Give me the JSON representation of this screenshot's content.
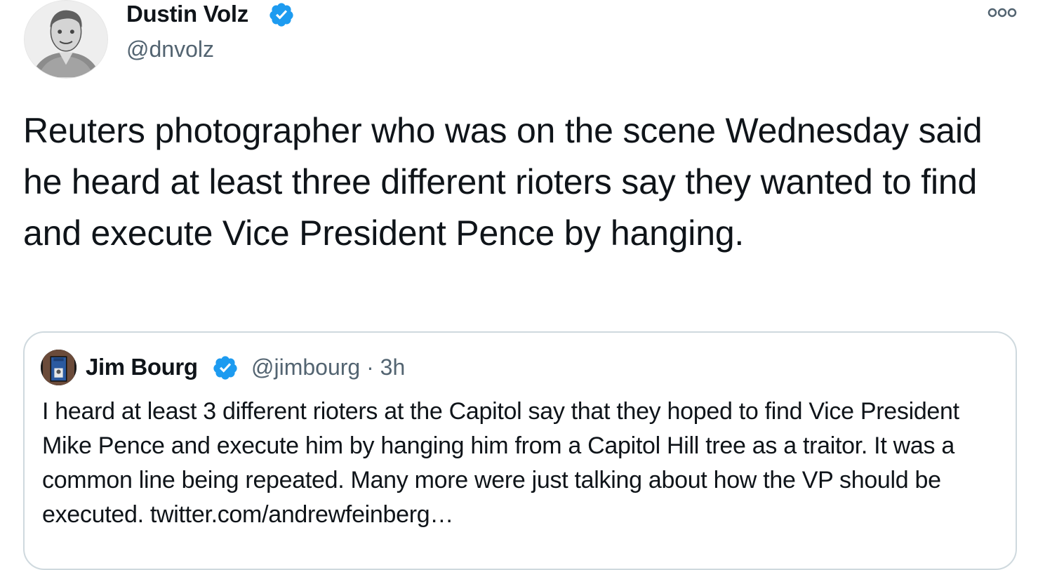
{
  "tweet": {
    "author_name": "Dustin Volz",
    "author_handle": "@dnvolz",
    "verified": true,
    "text": "Reuters photographer who was on the scene Wednesday said he heard at least three different rioters say they wanted to find and execute Vice President Pence by hanging."
  },
  "quoted_tweet": {
    "author_name": "Jim Bourg",
    "author_handle": "@jimbourg",
    "separator": "·",
    "time": "3h",
    "verified": true,
    "text": "I heard at least 3 different rioters at the Capitol say that they hoped to find Vice President Mike Pence and execute him by hanging him from a Capitol Hill tree as a traitor. It was a common line being repeated. Many more were just talking about how the VP should be executed. twitter.com/andrewfeinberg…"
  },
  "icons": {
    "verified": "verified-badge-icon",
    "more": "more-options-icon"
  },
  "colors": {
    "text_primary": "#0f1419",
    "text_secondary": "#536471",
    "verified_blue": "#1d9bf0",
    "card_border": "#cfd9de"
  }
}
